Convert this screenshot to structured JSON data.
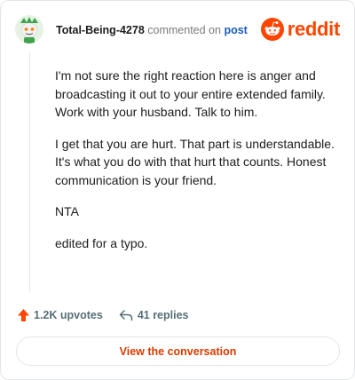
{
  "header": {
    "author": "Total-Being-4278",
    "action_text": "commented on",
    "target_link": "post",
    "brand_name": "reddit"
  },
  "comment": {
    "paragraphs": [
      "I'm not sure the right reaction here is anger and broadcasting it out to your entire extended family. Work with your husband. Talk to him.",
      "I get that you are hurt. That part is understandable. It's what you do with that hurt that counts. Honest communication is your friend.",
      "NTA",
      "edited for a typo."
    ]
  },
  "actions": {
    "upvotes": "1.2K upvotes",
    "replies": "41 replies"
  },
  "cta": {
    "label": "View the conversation"
  },
  "colors": {
    "brand": "#ff4500",
    "link": "#1a5bb8",
    "cta_text": "#d93a00",
    "muted": "#576f76"
  },
  "icons": {
    "avatar": "snoo-avatar-icon",
    "brand": "reddit-logo-icon",
    "upvote": "upvote-arrow-icon",
    "reply": "reply-arrow-icon"
  }
}
